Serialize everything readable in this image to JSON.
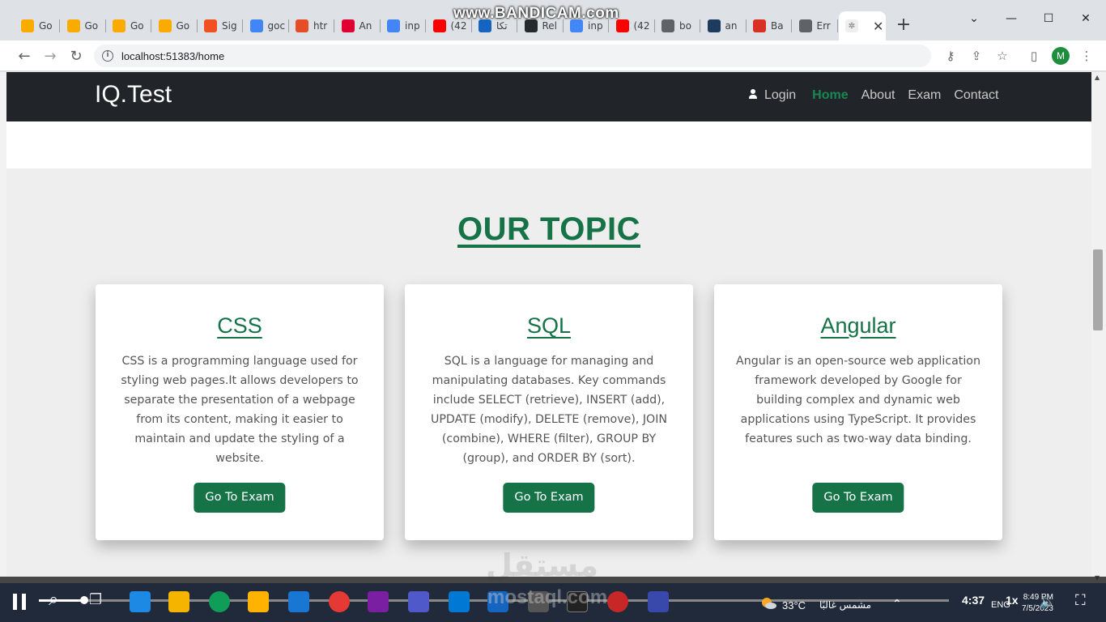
{
  "browser": {
    "recorder_watermark": "www.BANDICAM.com",
    "tabs": [
      {
        "label": "Go",
        "icon": "gdrive-icon",
        "color": "#f9ab00"
      },
      {
        "label": "Go",
        "icon": "gdrive-icon",
        "color": "#f9ab00"
      },
      {
        "label": "Go",
        "icon": "gdrive-icon",
        "color": "#f9ab00"
      },
      {
        "label": "Go",
        "icon": "gdrive-icon",
        "color": "#f9ab00"
      },
      {
        "label": "Sig",
        "icon": "microsoft-icon",
        "color": "#f25022"
      },
      {
        "label": "goc",
        "icon": "google-icon",
        "color": "#4285f4"
      },
      {
        "label": "htr",
        "icon": "html-icon",
        "color": "#e44d26"
      },
      {
        "label": "An",
        "icon": "angular-icon",
        "color": "#dd0031"
      },
      {
        "label": "inp",
        "icon": "google-icon",
        "color": "#4285f4"
      },
      {
        "label": "(42",
        "icon": "youtube-icon",
        "color": "#ff0000"
      },
      {
        "label": "تكا",
        "icon": "e-icon",
        "color": "#1565c0"
      },
      {
        "label": "Rel",
        "icon": "github-icon",
        "color": "#24292e"
      },
      {
        "label": "inp",
        "icon": "google-icon",
        "color": "#4285f4"
      },
      {
        "label": "(42",
        "icon": "youtube-icon",
        "color": "#ff0000"
      },
      {
        "label": "bo",
        "icon": "globe-icon",
        "color": "#5f6368"
      },
      {
        "label": "an",
        "icon": "vscode-icon",
        "color": "#1e3a5f"
      },
      {
        "label": "Ba",
        "icon": "record-icon",
        "color": "#d93025"
      },
      {
        "label": "Err",
        "icon": "globe-icon",
        "color": "#5f6368"
      }
    ],
    "url": "localhost:51383/home",
    "profile_initial": "M"
  },
  "site": {
    "brand": "IQ.Test",
    "nav": {
      "login": "Login",
      "home": "Home",
      "about": "About",
      "exam": "Exam",
      "contact": "Contact"
    },
    "section_title": "OUR TOPIC",
    "cards": [
      {
        "title": "CSS",
        "text": "CSS is a programming language used for styling web pages.It allows developers to separate the presentation of a webpage from its content, making it easier to maintain and update the styling of a website.",
        "button": "Go To Exam"
      },
      {
        "title": "SQL",
        "text": "SQL is a language for managing and manipulating databases. Key commands include SELECT (retrieve), INSERT (add), UPDATE (modify), DELETE (remove), JOIN (combine), WHERE (filter), GROUP BY (group), and ORDER BY (sort).",
        "button": "Go To Exam"
      },
      {
        "title": "Angular",
        "text": "Angular is an open-source web application framework developed by Google for building complex and dynamic web applications using TypeScript. It provides features such as two-way data binding.",
        "button": "Go To Exam"
      }
    ],
    "colors": {
      "navbar": "#212529",
      "accent": "#157347"
    }
  },
  "player": {
    "time": "4:37",
    "speed": "1x",
    "progress": 0.05
  },
  "taskbar": {
    "weather_temp": "33°C",
    "weather_desc": "مشمس غالبًا",
    "lang": "ENG",
    "clock_time": "8:49 PM",
    "clock_date": "7/5/2023"
  },
  "watermark": {
    "brand_ar": "مستقل",
    "brand_en": "mostaql.com"
  }
}
